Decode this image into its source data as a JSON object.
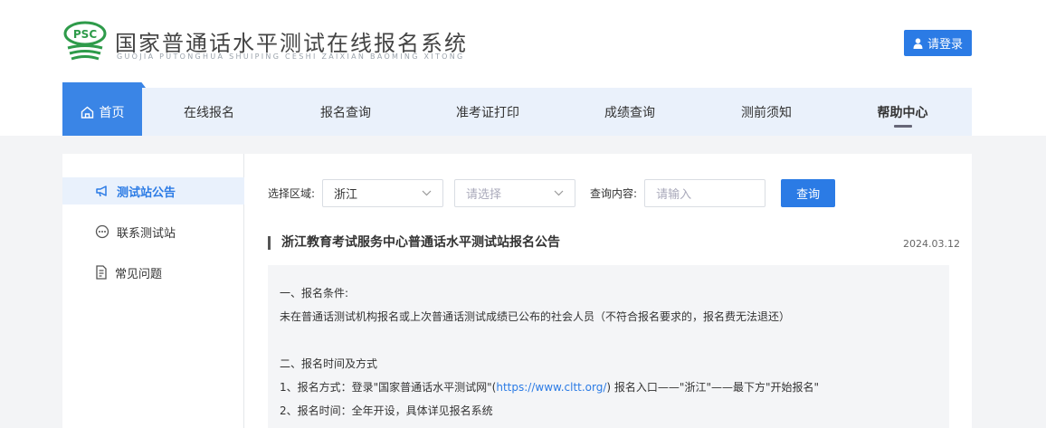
{
  "header": {
    "logo_text": "PSC",
    "site_title": "国家普通话水平测试在线报名系统",
    "site_subtitle": "GUOJIA PUTONGHUA SHUIPING CESHI ZAIXIAN BAOMING XITONG",
    "login_label": "请登录"
  },
  "nav": {
    "items": [
      {
        "label": "首页",
        "icon": "home-icon",
        "active": true
      },
      {
        "label": "在线报名"
      },
      {
        "label": "报名查询"
      },
      {
        "label": "准考证打印"
      },
      {
        "label": "成绩查询"
      },
      {
        "label": "测前须知"
      },
      {
        "label": "帮助中心",
        "current": true
      }
    ]
  },
  "sidebar": {
    "items": [
      {
        "label": "测试站公告",
        "icon": "megaphone-icon",
        "active": true
      },
      {
        "label": "联系测试站",
        "icon": "chat-icon"
      },
      {
        "label": "常见问题",
        "icon": "document-icon"
      }
    ]
  },
  "filters": {
    "region_label": "选择区域:",
    "region_value": "浙江",
    "city_placeholder": "请选择",
    "query_label": "查询内容:",
    "query_placeholder": "请输入",
    "query_button": "查询"
  },
  "notice": {
    "title": "浙江教育考试服务中心普通话水平测试站报名公告",
    "date": "2024.03.12",
    "lines": {
      "l1": "一、报名条件:",
      "l2": "未在普通话测试机构报名或上次普通话测试成绩已公布的社会人员（不符合报名要求的，报名费无法退还）",
      "l3": "二、报名时间及方式",
      "l4_pre": "1、报名方式：登录\"国家普通话水平测试网\"(",
      "l4_link": "https://www.cltt.org/",
      "l4_post": ")  报名入口——\"浙江\"——最下方\"开始报名\"",
      "l5": "2、报名时间：全年开设，具体详见报名系统"
    }
  },
  "colors": {
    "accent": "#2b7be5",
    "nav_bg": "#eaf1fb",
    "page_bg": "#f3f4f6"
  }
}
